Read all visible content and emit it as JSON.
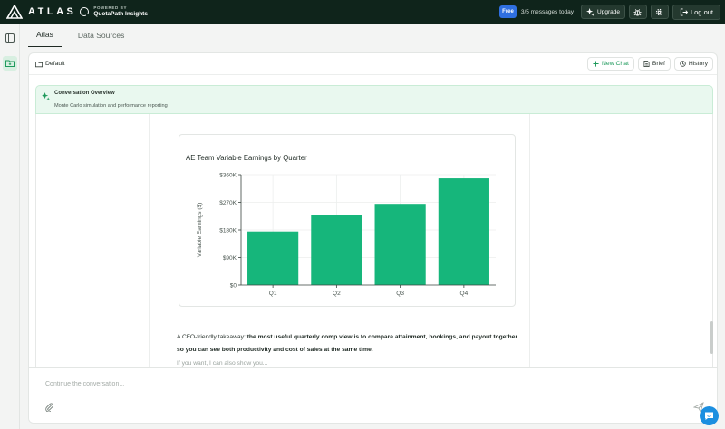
{
  "brand": {
    "name": "ATLAS",
    "powered_by": "POWERED BY",
    "powered_name": "QuotaPath Insights"
  },
  "topbar": {
    "plan_badge": "Free",
    "message_count": "3/5 messages today",
    "upgrade_label": "Upgrade",
    "logout_label": "Log out"
  },
  "tabs": [
    {
      "label": "Atlas",
      "active": true
    },
    {
      "label": "Data Sources",
      "active": false
    }
  ],
  "panel": {
    "folder_label": "Default",
    "new_chat_label": "New Chat",
    "brief_label": "Brief",
    "history_label": "History"
  },
  "overview": {
    "title": "Conversation Overview",
    "subtitle": "Monte Carlo simulation and performance reporting"
  },
  "chart_data": {
    "type": "bar",
    "title": "AE Team Variable Earnings by Quarter",
    "xlabel": "",
    "ylabel": "Variable Earnings ($)",
    "categories": [
      "Q1",
      "Q2",
      "Q3",
      "Q4"
    ],
    "values": [
      175000,
      228000,
      265000,
      348000
    ],
    "ylim": [
      0,
      360000
    ],
    "yticks": [
      0,
      90000,
      180000,
      270000,
      360000
    ],
    "ytick_labels": [
      "$0",
      "$90K",
      "$180K",
      "$270K",
      "$360K"
    ],
    "grid": true,
    "bar_color": "#16b67b"
  },
  "message": {
    "prefix": "A CFO-friendly takeaway: ",
    "bold": "the most useful quarterly comp view is to compare attainment, bookings, and payout together so you can see both productivity and cost of sales at the same time.",
    "cut_line": "If you want, I can also show you..."
  },
  "composer": {
    "placeholder": "Continue the conversation..."
  },
  "colors": {
    "accent": "#16b67b",
    "topbar": "#0f241b",
    "badge": "#2f6fe0",
    "overview_bg": "#e9f8ef"
  },
  "icons": {
    "rail": [
      "sidebar-toggle-icon",
      "folder-icon"
    ],
    "topbar": [
      "sparkle-icon",
      "bug-icon",
      "gear-icon",
      "logout-icon"
    ],
    "composer": [
      "paperclip-icon",
      "send-icon"
    ],
    "help": "chat-bubble-icon"
  }
}
